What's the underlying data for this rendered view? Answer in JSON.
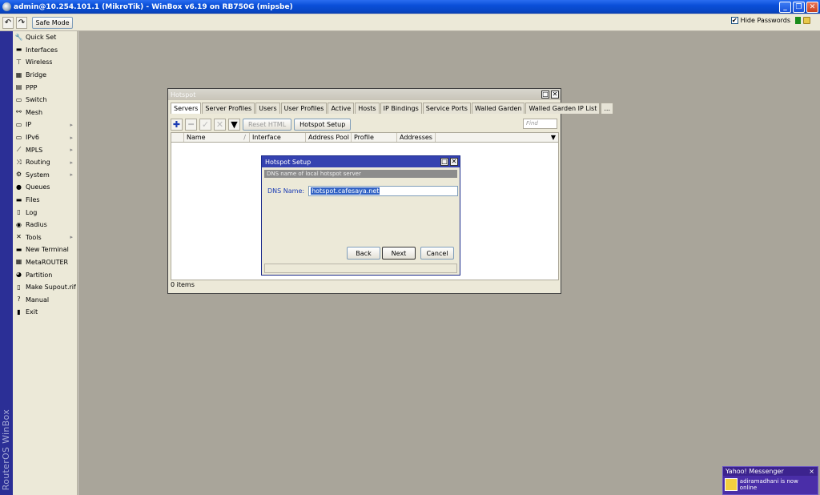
{
  "window": {
    "title": "admin@10.254.101.1 (MikroTik) - WinBox v6.19 on RB750G (mipsbe)",
    "buttons": [
      "_",
      "❐",
      "✕"
    ]
  },
  "toolbar": {
    "back_icon": "↶",
    "forward_icon": "↷",
    "safe_mode_label": "Safe Mode",
    "hide_passwords_label": "Hide Passwords",
    "hide_passwords_checked": "✔"
  },
  "brand": "RouterOS WinBox",
  "sidebar": {
    "items": [
      {
        "label": "Quick Set",
        "icon": "🔧"
      },
      {
        "label": "Interfaces",
        "icon": "▬"
      },
      {
        "label": "Wireless",
        "icon": "⊤"
      },
      {
        "label": "Bridge",
        "icon": "▦"
      },
      {
        "label": "PPP",
        "icon": "▤"
      },
      {
        "label": "Switch",
        "icon": "▭"
      },
      {
        "label": "Mesh",
        "icon": "⚯"
      },
      {
        "label": "IP",
        "icon": "▭",
        "submenu": "▸"
      },
      {
        "label": "IPv6",
        "icon": "▭",
        "submenu": "▸"
      },
      {
        "label": "MPLS",
        "icon": "⟋",
        "submenu": "▸"
      },
      {
        "label": "Routing",
        "icon": "⤨",
        "submenu": "▸"
      },
      {
        "label": "System",
        "icon": "⚙",
        "submenu": "▸"
      },
      {
        "label": "Queues",
        "icon": "●"
      },
      {
        "label": "Files",
        "icon": "▬"
      },
      {
        "label": "Log",
        "icon": "▯"
      },
      {
        "label": "Radius",
        "icon": "◉"
      },
      {
        "label": "Tools",
        "icon": "✕",
        "submenu": "▸"
      },
      {
        "label": "New Terminal",
        "icon": "▬"
      },
      {
        "label": "MetaROUTER",
        "icon": "▦"
      },
      {
        "label": "Partition",
        "icon": "◕"
      },
      {
        "label": "Make Supout.rif",
        "icon": "▯"
      },
      {
        "label": "Manual",
        "icon": "?"
      },
      {
        "label": "Exit",
        "icon": "▮"
      }
    ]
  },
  "hotspot": {
    "title": "Hotspot",
    "tabs": [
      "Servers",
      "Server Profiles",
      "Users",
      "User Profiles",
      "Active",
      "Hosts",
      "IP Bindings",
      "Service Ports",
      "Walled Garden",
      "Walled Garden IP List",
      "..."
    ],
    "active_tab": "Servers",
    "tool_icons": {
      "add": "✚",
      "remove": "━",
      "enable": "✓",
      "disable": "✕",
      "filter": "▼"
    },
    "reset_html_label": "Reset HTML",
    "hotspot_setup_label": "Hotspot Setup",
    "find_placeholder": "Find",
    "columns": [
      "Name",
      "Interface",
      "Address Pool",
      "Profile",
      "Addresses ..."
    ],
    "sort_glyph": "/",
    "dropdown_glyph": "▼",
    "status": "0 items"
  },
  "dialog": {
    "title": "Hotspot Setup",
    "subtitle": "DNS name of local hotspot server",
    "dns_label": "DNS Name:",
    "dns_value": "hotspot.cafesaya.net",
    "back_label": "Back",
    "next_label": "Next",
    "cancel_label": "Cancel"
  },
  "toast": {
    "title": "Yahoo! Messenger",
    "message": "adiramadhani is now online",
    "close": "×"
  },
  "colors": {
    "titlebar": "#0a4fd8",
    "brandbar": "#2b2f96",
    "dialog_title": "#3542b0",
    "workarea": "#a9a59a"
  }
}
